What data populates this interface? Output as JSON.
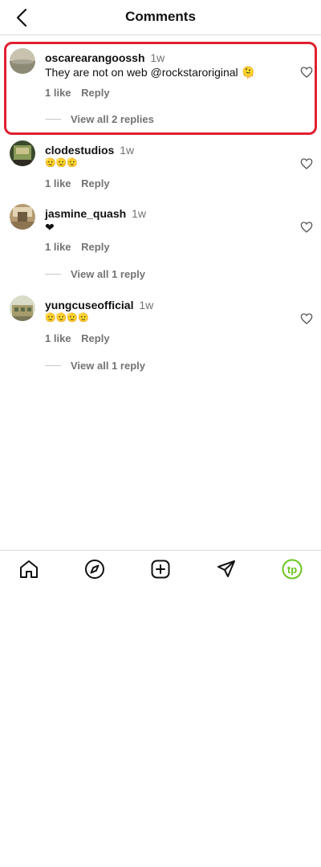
{
  "header": {
    "title": "Comments"
  },
  "comments": [
    {
      "username": "oscarearangoossh",
      "time": "1w",
      "text": "They are not on web @rockstaroriginal 🫠",
      "likes": "1 like",
      "reply": "Reply",
      "view_replies": "View all 2 replies"
    },
    {
      "username": "clodestudios",
      "time": "1w",
      "text": "🫡🫡🫡",
      "likes": "1 like",
      "reply": "Reply"
    },
    {
      "username": "jasmine_quash",
      "time": "1w",
      "text": "❤",
      "likes": "1 like",
      "reply": "Reply",
      "view_replies": "View all 1 reply"
    },
    {
      "username": "yungcuseofficial",
      "time": "1w",
      "text": "🫡🫡🫡🫡",
      "likes": "1 like",
      "reply": "Reply",
      "view_replies": "View all 1 reply"
    }
  ],
  "nav": {
    "items": [
      "home-icon",
      "explore-icon",
      "create-icon",
      "direct-icon",
      "profile-icon"
    ],
    "profile_initials": "tp",
    "accent": "#6cc521"
  },
  "colors": {
    "highlight": "#e0202f",
    "muted": "#737373"
  }
}
